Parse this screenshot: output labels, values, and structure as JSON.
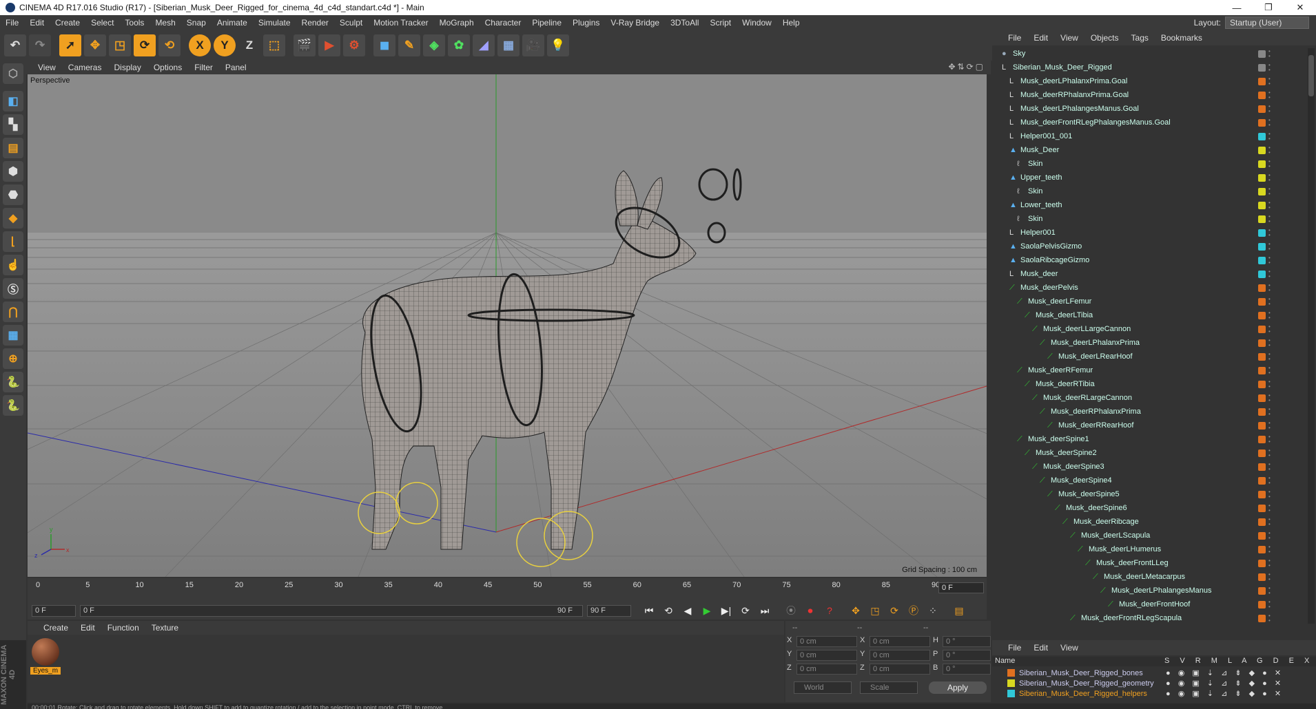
{
  "titlebar": {
    "title": "CINEMA 4D R17.016 Studio (R17) - [Siberian_Musk_Deer_Rigged_for_cinema_4d_c4d_standart.c4d *] - Main",
    "minimize": "—",
    "restore": "❐",
    "close": "✕"
  },
  "menubar": {
    "items": [
      "File",
      "Edit",
      "Create",
      "Select",
      "Tools",
      "Mesh",
      "Snap",
      "Animate",
      "Simulate",
      "Render",
      "Sculpt",
      "Motion Tracker",
      "MoGraph",
      "Character",
      "Pipeline",
      "Plugins",
      "V-Ray Bridge",
      "3DToAll",
      "Script",
      "Window",
      "Help"
    ],
    "layout_label": "Layout:",
    "layout_value": "Startup (User)"
  },
  "toolbar": {
    "icons": [
      "undo-icon",
      "redo-icon",
      "select-arrow-icon",
      "move-icon",
      "scale-icon",
      "rotate-icon",
      "recent-tool-icon",
      "x-axis-icon",
      "y-axis-icon",
      "z-axis-icon",
      "coord-system-icon",
      "render-view-icon",
      "render-picture-viewer-icon",
      "render-settings-icon",
      "cube-icon",
      "pen-icon",
      "subdivision-icon",
      "cloner-icon",
      "deformer-icon",
      "floor-icon",
      "camera-icon",
      "light-icon"
    ],
    "x_label": "X",
    "y_label": "Y",
    "z_label": "Z"
  },
  "viewport_menu": {
    "items": [
      "View",
      "Cameras",
      "Display",
      "Options",
      "Filter",
      "Panel"
    ]
  },
  "viewport": {
    "label": "Perspective",
    "grid_spacing": "Grid Spacing : 100 cm",
    "axis_x": "x",
    "axis_y": "y",
    "axis_z": "z"
  },
  "timeline": {
    "ticks": [
      "0",
      "5",
      "10",
      "15",
      "20",
      "25",
      "30",
      "35",
      "40",
      "45",
      "50",
      "55",
      "60",
      "65",
      "70",
      "75",
      "80",
      "85",
      "90"
    ],
    "frame_box": "0 F"
  },
  "transport": {
    "start_frame": "0 F",
    "range_start": "0 F",
    "range_end": "90 F",
    "end_frame": "90 F"
  },
  "material_menu": {
    "items": [
      "Create",
      "Edit",
      "Function",
      "Texture"
    ]
  },
  "materials": [
    {
      "name": "Eyes_m"
    }
  ],
  "coords": {
    "header_dashes": "--",
    "header_dashes2": "--",
    "header_dashes3": "--",
    "rows": [
      {
        "l1": "X",
        "v1": "0 cm",
        "l2": "X",
        "v2": "0 cm",
        "l3": "H",
        "v3": "0 °"
      },
      {
        "l1": "Y",
        "v1": "0 cm",
        "l2": "Y",
        "v2": "0 cm",
        "l3": "P",
        "v3": "0 °"
      },
      {
        "l1": "Z",
        "v1": "0 cm",
        "l2": "Z",
        "v2": "0 cm",
        "l3": "B",
        "v3": "0 °"
      }
    ],
    "mode1": "World",
    "mode2": "Scale",
    "apply": "Apply"
  },
  "status": {
    "text": "00:00:01  Rotate: Click and drag to rotate elements. Hold down SHIFT to add to quantize rotation / add to the selection in point mode, CTRL to remove."
  },
  "brand": {
    "text": "MAXON CINEMA 4D"
  },
  "object_manager": {
    "menu": [
      "File",
      "Edit",
      "View",
      "Objects",
      "Tags",
      "Bookmarks"
    ],
    "rows": [
      {
        "name": "Sky",
        "depth": 0,
        "icon": "sky-icon",
        "tag": "#888888"
      },
      {
        "name": "Siberian_Musk_Deer_Rigged",
        "depth": 0,
        "icon": "null-icon",
        "tag": "#888888"
      },
      {
        "name": "Musk_deerLPhalanxPrima.Goal",
        "depth": 1,
        "icon": "null-icon",
        "tag": "#e07020"
      },
      {
        "name": "Musk_deerRPhalanxPrima.Goal",
        "depth": 1,
        "icon": "null-icon",
        "tag": "#e07020"
      },
      {
        "name": "Musk_deerLPhalangesManus.Goal",
        "depth": 1,
        "icon": "null-icon",
        "tag": "#e07020"
      },
      {
        "name": "Musk_deerFrontRLegPhalangesManus.Goal",
        "depth": 1,
        "icon": "null-icon",
        "tag": "#e07020"
      },
      {
        "name": "Helper001_001",
        "depth": 1,
        "icon": "null-icon",
        "tag": "#30c8d8"
      },
      {
        "name": "Musk_Deer",
        "depth": 1,
        "icon": "polygon-icon",
        "tag": "#d8d820"
      },
      {
        "name": "Skin",
        "depth": 2,
        "icon": "skin-icon",
        "tag": "#d8d820"
      },
      {
        "name": "Upper_teeth",
        "depth": 1,
        "icon": "polygon-icon",
        "tag": "#d8d820"
      },
      {
        "name": "Skin",
        "depth": 2,
        "icon": "skin-icon",
        "tag": "#d8d820"
      },
      {
        "name": "Lower_teeth",
        "depth": 1,
        "icon": "polygon-icon",
        "tag": "#d8d820"
      },
      {
        "name": "Skin",
        "depth": 2,
        "icon": "skin-icon",
        "tag": "#d8d820"
      },
      {
        "name": "Helper001",
        "depth": 1,
        "icon": "null-icon",
        "tag": "#30c8d8"
      },
      {
        "name": "SaolaPelvisGizmo",
        "depth": 1,
        "icon": "polygon-icon",
        "tag": "#30c8d8"
      },
      {
        "name": "SaolaRibcageGizmo",
        "depth": 1,
        "icon": "polygon-icon",
        "tag": "#30c8d8"
      },
      {
        "name": "Musk_deer",
        "depth": 1,
        "icon": "null-icon",
        "tag": "#30c8d8"
      },
      {
        "name": "Musk_deerPelvis",
        "depth": 1,
        "icon": "joint-icon",
        "tag": "#e07020"
      },
      {
        "name": "Musk_deerLFemur",
        "depth": 2,
        "icon": "joint-icon",
        "tag": "#e07020"
      },
      {
        "name": "Musk_deerLTibia",
        "depth": 3,
        "icon": "joint-icon",
        "tag": "#e07020"
      },
      {
        "name": "Musk_deerLLargeCannon",
        "depth": 4,
        "icon": "joint-icon",
        "tag": "#e07020"
      },
      {
        "name": "Musk_deerLPhalanxPrima",
        "depth": 5,
        "icon": "joint-icon",
        "tag": "#e07020"
      },
      {
        "name": "Musk_deerLRearHoof",
        "depth": 6,
        "icon": "joint-icon",
        "tag": "#e07020"
      },
      {
        "name": "Musk_deerRFemur",
        "depth": 2,
        "icon": "joint-icon",
        "tag": "#e07020"
      },
      {
        "name": "Musk_deerRTibia",
        "depth": 3,
        "icon": "joint-icon",
        "tag": "#e07020"
      },
      {
        "name": "Musk_deerRLargeCannon",
        "depth": 4,
        "icon": "joint-icon",
        "tag": "#e07020"
      },
      {
        "name": "Musk_deerRPhalanxPrima",
        "depth": 5,
        "icon": "joint-icon",
        "tag": "#e07020"
      },
      {
        "name": "Musk_deerRRearHoof",
        "depth": 6,
        "icon": "joint-icon",
        "tag": "#e07020"
      },
      {
        "name": "Musk_deerSpine1",
        "depth": 2,
        "icon": "joint-icon",
        "tag": "#e07020"
      },
      {
        "name": "Musk_deerSpine2",
        "depth": 3,
        "icon": "joint-icon",
        "tag": "#e07020"
      },
      {
        "name": "Musk_deerSpine3",
        "depth": 4,
        "icon": "joint-icon",
        "tag": "#e07020"
      },
      {
        "name": "Musk_deerSpine4",
        "depth": 5,
        "icon": "joint-icon",
        "tag": "#e07020"
      },
      {
        "name": "Musk_deerSpine5",
        "depth": 6,
        "icon": "joint-icon",
        "tag": "#e07020"
      },
      {
        "name": "Musk_deerSpine6",
        "depth": 7,
        "icon": "joint-icon",
        "tag": "#e07020"
      },
      {
        "name": "Musk_deerRibcage",
        "depth": 8,
        "icon": "joint-icon",
        "tag": "#e07020"
      },
      {
        "name": "Musk_deerLScapula",
        "depth": 9,
        "icon": "joint-icon",
        "tag": "#e07020"
      },
      {
        "name": "Musk_deerLHumerus",
        "depth": 10,
        "icon": "joint-icon",
        "tag": "#e07020"
      },
      {
        "name": "Musk_deerFrontLLeg",
        "depth": 11,
        "icon": "joint-icon",
        "tag": "#e07020"
      },
      {
        "name": "Musk_deerLMetacarpus",
        "depth": 12,
        "icon": "joint-icon",
        "tag": "#e07020"
      },
      {
        "name": "Musk_deerLPhalangesManus",
        "depth": 13,
        "icon": "joint-icon",
        "tag": "#e07020"
      },
      {
        "name": "Musk_deerFrontHoof",
        "depth": 14,
        "icon": "joint-icon",
        "tag": "#e07020"
      },
      {
        "name": "Musk_deerFrontRLegScapula",
        "depth": 9,
        "icon": "joint-icon",
        "tag": "#e07020"
      }
    ]
  },
  "layer_manager": {
    "menu": [
      "File",
      "Edit",
      "View"
    ],
    "name_header": "Name",
    "col_headers": "S V R M L A G D E X",
    "layers": [
      {
        "name": "Siberian_Musk_Deer_Rigged_bones",
        "color": "#e07020"
      },
      {
        "name": "Siberian_Musk_Deer_Rigged_geometry",
        "color": "#d8d820"
      },
      {
        "name": "Siberian_Musk_Deer_Rigged_helpers",
        "color": "#30c8d8"
      }
    ]
  },
  "colors": {
    "accent_orange": "#f0a020",
    "ui_bg": "#333333",
    "viewport_bg": "#8c8c8c"
  }
}
